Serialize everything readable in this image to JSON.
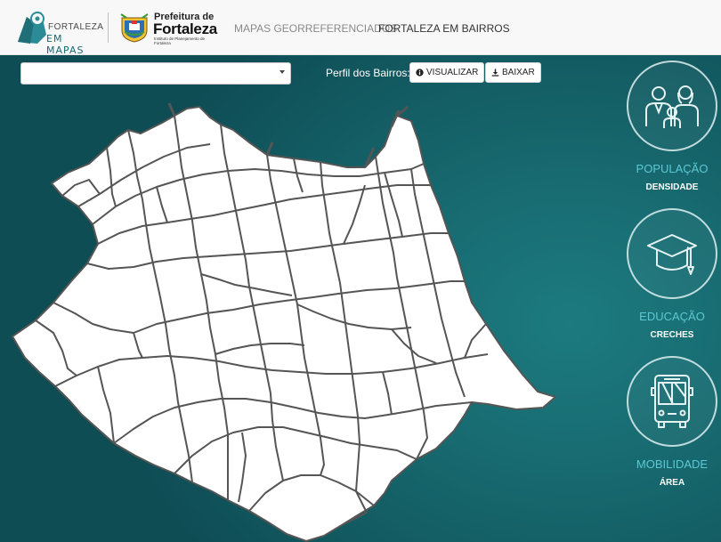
{
  "brand": {
    "line1": "FORTALEZA",
    "line2": "EM MAPAS"
  },
  "prefeitura": {
    "prefix": "Prefeitura de",
    "name": "Fortaleza",
    "sub": "Instituto de Planejamento de Fortaleza"
  },
  "nav": {
    "mapas": "MAPAS GEORREFERENCIADOS",
    "bairros": "FORTALEZA EM BAIRROS"
  },
  "toolbar": {
    "select_value": "",
    "perfil_label": "Perfil dos Bairros:",
    "visualizar": "VISUALIZAR",
    "baixar": "BAIXAR"
  },
  "themes": [
    {
      "title": "POPULAÇÃO",
      "subtitle": "DENSIDADE",
      "icon": "people-icon"
    },
    {
      "title": "EDUCAÇÃO",
      "subtitle": "CRECHES",
      "icon": "graduation-cap-icon"
    },
    {
      "title": "MOBILIDADE",
      "subtitle": "ÁREA",
      "icon": "bus-icon"
    }
  ],
  "colors": {
    "accent": "#5cc8d3",
    "background": "#176a70",
    "map_fill": "#ffffff",
    "map_stroke": "#555555"
  }
}
